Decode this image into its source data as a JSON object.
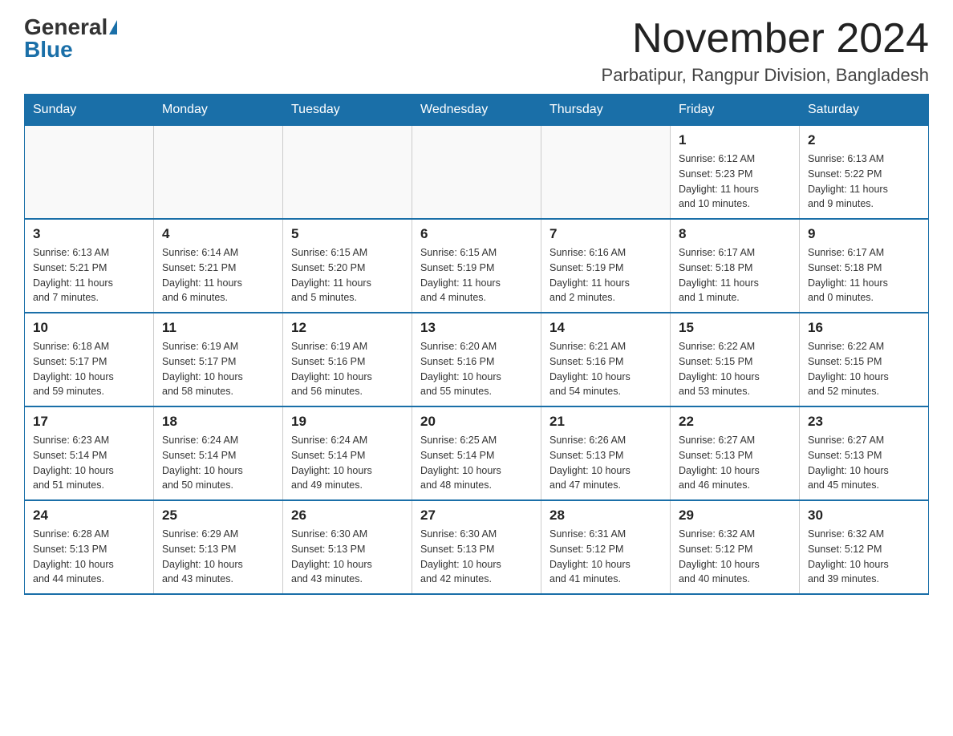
{
  "logo": {
    "general": "General",
    "blue": "Blue"
  },
  "header": {
    "month_title": "November 2024",
    "location": "Parbatipur, Rangpur Division, Bangladesh"
  },
  "weekdays": [
    "Sunday",
    "Monday",
    "Tuesday",
    "Wednesday",
    "Thursday",
    "Friday",
    "Saturday"
  ],
  "weeks": [
    [
      {
        "day": "",
        "info": ""
      },
      {
        "day": "",
        "info": ""
      },
      {
        "day": "",
        "info": ""
      },
      {
        "day": "",
        "info": ""
      },
      {
        "day": "",
        "info": ""
      },
      {
        "day": "1",
        "info": "Sunrise: 6:12 AM\nSunset: 5:23 PM\nDaylight: 11 hours\nand 10 minutes."
      },
      {
        "day": "2",
        "info": "Sunrise: 6:13 AM\nSunset: 5:22 PM\nDaylight: 11 hours\nand 9 minutes."
      }
    ],
    [
      {
        "day": "3",
        "info": "Sunrise: 6:13 AM\nSunset: 5:21 PM\nDaylight: 11 hours\nand 7 minutes."
      },
      {
        "day": "4",
        "info": "Sunrise: 6:14 AM\nSunset: 5:21 PM\nDaylight: 11 hours\nand 6 minutes."
      },
      {
        "day": "5",
        "info": "Sunrise: 6:15 AM\nSunset: 5:20 PM\nDaylight: 11 hours\nand 5 minutes."
      },
      {
        "day": "6",
        "info": "Sunrise: 6:15 AM\nSunset: 5:19 PM\nDaylight: 11 hours\nand 4 minutes."
      },
      {
        "day": "7",
        "info": "Sunrise: 6:16 AM\nSunset: 5:19 PM\nDaylight: 11 hours\nand 2 minutes."
      },
      {
        "day": "8",
        "info": "Sunrise: 6:17 AM\nSunset: 5:18 PM\nDaylight: 11 hours\nand 1 minute."
      },
      {
        "day": "9",
        "info": "Sunrise: 6:17 AM\nSunset: 5:18 PM\nDaylight: 11 hours\nand 0 minutes."
      }
    ],
    [
      {
        "day": "10",
        "info": "Sunrise: 6:18 AM\nSunset: 5:17 PM\nDaylight: 10 hours\nand 59 minutes."
      },
      {
        "day": "11",
        "info": "Sunrise: 6:19 AM\nSunset: 5:17 PM\nDaylight: 10 hours\nand 58 minutes."
      },
      {
        "day": "12",
        "info": "Sunrise: 6:19 AM\nSunset: 5:16 PM\nDaylight: 10 hours\nand 56 minutes."
      },
      {
        "day": "13",
        "info": "Sunrise: 6:20 AM\nSunset: 5:16 PM\nDaylight: 10 hours\nand 55 minutes."
      },
      {
        "day": "14",
        "info": "Sunrise: 6:21 AM\nSunset: 5:16 PM\nDaylight: 10 hours\nand 54 minutes."
      },
      {
        "day": "15",
        "info": "Sunrise: 6:22 AM\nSunset: 5:15 PM\nDaylight: 10 hours\nand 53 minutes."
      },
      {
        "day": "16",
        "info": "Sunrise: 6:22 AM\nSunset: 5:15 PM\nDaylight: 10 hours\nand 52 minutes."
      }
    ],
    [
      {
        "day": "17",
        "info": "Sunrise: 6:23 AM\nSunset: 5:14 PM\nDaylight: 10 hours\nand 51 minutes."
      },
      {
        "day": "18",
        "info": "Sunrise: 6:24 AM\nSunset: 5:14 PM\nDaylight: 10 hours\nand 50 minutes."
      },
      {
        "day": "19",
        "info": "Sunrise: 6:24 AM\nSunset: 5:14 PM\nDaylight: 10 hours\nand 49 minutes."
      },
      {
        "day": "20",
        "info": "Sunrise: 6:25 AM\nSunset: 5:14 PM\nDaylight: 10 hours\nand 48 minutes."
      },
      {
        "day": "21",
        "info": "Sunrise: 6:26 AM\nSunset: 5:13 PM\nDaylight: 10 hours\nand 47 minutes."
      },
      {
        "day": "22",
        "info": "Sunrise: 6:27 AM\nSunset: 5:13 PM\nDaylight: 10 hours\nand 46 minutes."
      },
      {
        "day": "23",
        "info": "Sunrise: 6:27 AM\nSunset: 5:13 PM\nDaylight: 10 hours\nand 45 minutes."
      }
    ],
    [
      {
        "day": "24",
        "info": "Sunrise: 6:28 AM\nSunset: 5:13 PM\nDaylight: 10 hours\nand 44 minutes."
      },
      {
        "day": "25",
        "info": "Sunrise: 6:29 AM\nSunset: 5:13 PM\nDaylight: 10 hours\nand 43 minutes."
      },
      {
        "day": "26",
        "info": "Sunrise: 6:30 AM\nSunset: 5:13 PM\nDaylight: 10 hours\nand 43 minutes."
      },
      {
        "day": "27",
        "info": "Sunrise: 6:30 AM\nSunset: 5:13 PM\nDaylight: 10 hours\nand 42 minutes."
      },
      {
        "day": "28",
        "info": "Sunrise: 6:31 AM\nSunset: 5:12 PM\nDaylight: 10 hours\nand 41 minutes."
      },
      {
        "day": "29",
        "info": "Sunrise: 6:32 AM\nSunset: 5:12 PM\nDaylight: 10 hours\nand 40 minutes."
      },
      {
        "day": "30",
        "info": "Sunrise: 6:32 AM\nSunset: 5:12 PM\nDaylight: 10 hours\nand 39 minutes."
      }
    ]
  ]
}
